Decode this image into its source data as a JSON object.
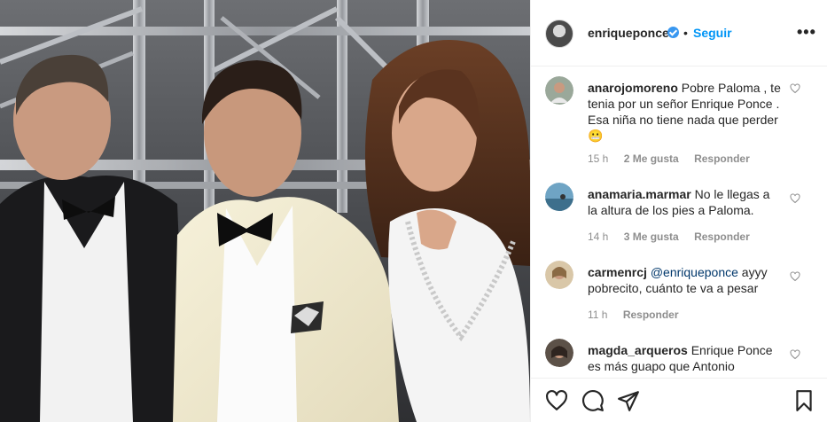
{
  "post": {
    "author": "enriqueponce",
    "verified": true,
    "follow_label": "Seguir",
    "separator": "•",
    "more_label": "•••"
  },
  "comments": [
    {
      "user": "anarojomoreno",
      "text": "Pobre Paloma , te tenia por un señor Enrique Ponce . Esa niña no tiene nada que perder",
      "emoji": "😬",
      "time": "15 h",
      "likes": "2 Me gusta",
      "reply": "Responder"
    },
    {
      "user": "anamaria.marmar",
      "text": "No le llegas a la altura de los pies a Paloma.",
      "time": "14 h",
      "likes": "3 Me gusta",
      "reply": "Responder"
    },
    {
      "user": "carmenrcj",
      "mention": "@enriqueponce",
      "text": "ayyy pobrecito, cuánto te va a pesar",
      "time": "11 h",
      "reply": "Responder"
    },
    {
      "user": "magda_arqueros",
      "text": "Enrique Ponce es más guapo que Antonio Banderas"
    }
  ],
  "colors": {
    "accent": "#0095f6",
    "verified": "#3897f0",
    "text": "#262626",
    "muted": "#8e8e8e",
    "border": "#efefef"
  },
  "icons": [
    "heart-icon",
    "comment-icon",
    "share-icon",
    "bookmark-icon",
    "more-options-icon",
    "verified-badge-icon"
  ]
}
